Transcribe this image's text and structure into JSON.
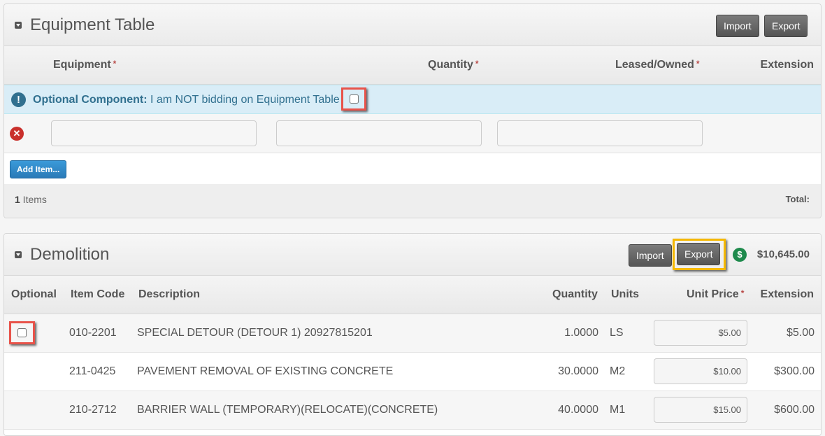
{
  "equipment_panel": {
    "title": "Equipment Table",
    "import_label": "Import",
    "export_label": "Export",
    "columns": [
      {
        "label": "Equipment",
        "required": "*"
      },
      {
        "label": "Quantity",
        "required": "*"
      },
      {
        "label": "Leased/Owned",
        "required": "*"
      },
      {
        "label": "Extension",
        "required": ""
      }
    ],
    "alert": {
      "icon": "exclamation-circle-icon",
      "strong": "Optional Component:",
      "text": " I am NOT bidding on Equipment Table",
      "checked": false
    },
    "row_inputs": [
      {
        "value": "",
        "placeholder": ""
      },
      {
        "value": "",
        "placeholder": ""
      },
      {
        "value": "",
        "placeholder": ""
      }
    ],
    "add_item_label": "Add Item...",
    "footer": {
      "count": "1",
      "count_suffix": " Items",
      "total_label": "Total:"
    }
  },
  "demolition_panel": {
    "title": "Demolition",
    "import_label": "Import",
    "export_label": "Export",
    "total": "$10,645.00",
    "columns": [
      {
        "label": "Optional",
        "required": ""
      },
      {
        "label": "Item Code",
        "required": ""
      },
      {
        "label": "Description",
        "required": ""
      },
      {
        "label": "Quantity",
        "required": ""
      },
      {
        "label": "Units",
        "required": ""
      },
      {
        "label": "Unit Price",
        "required": "*"
      },
      {
        "label": "Extension",
        "required": ""
      }
    ],
    "rows": [
      {
        "optional": true,
        "checked": false,
        "code": "010-2201",
        "description": "SPECIAL DETOUR (DETOUR 1) 20927815201",
        "quantity": "1.0000",
        "units": "LS",
        "unit_price": "$5.00",
        "extension": "$5.00"
      },
      {
        "optional": false,
        "code": "211-0425",
        "description": "PAVEMENT REMOVAL OF EXISTING CONCRETE",
        "quantity": "30.0000",
        "units": "M2",
        "unit_price": "$10.00",
        "extension": "$300.00"
      },
      {
        "optional": false,
        "code": "210-2712",
        "description": "BARRIER WALL (TEMPORARY)(RELOCATE)(CONCRETE)",
        "quantity": "40.0000",
        "units": "M1",
        "unit_price": "$15.00",
        "extension": "$600.00"
      }
    ]
  },
  "colors": {
    "info_bg": "#d9edf7",
    "info_text": "#31708f",
    "danger": "#c9302c",
    "primary": "#2a7ab7",
    "success": "#1e8a4c",
    "highlight_red": "#e8534a",
    "highlight_yellow": "#f5b800"
  }
}
